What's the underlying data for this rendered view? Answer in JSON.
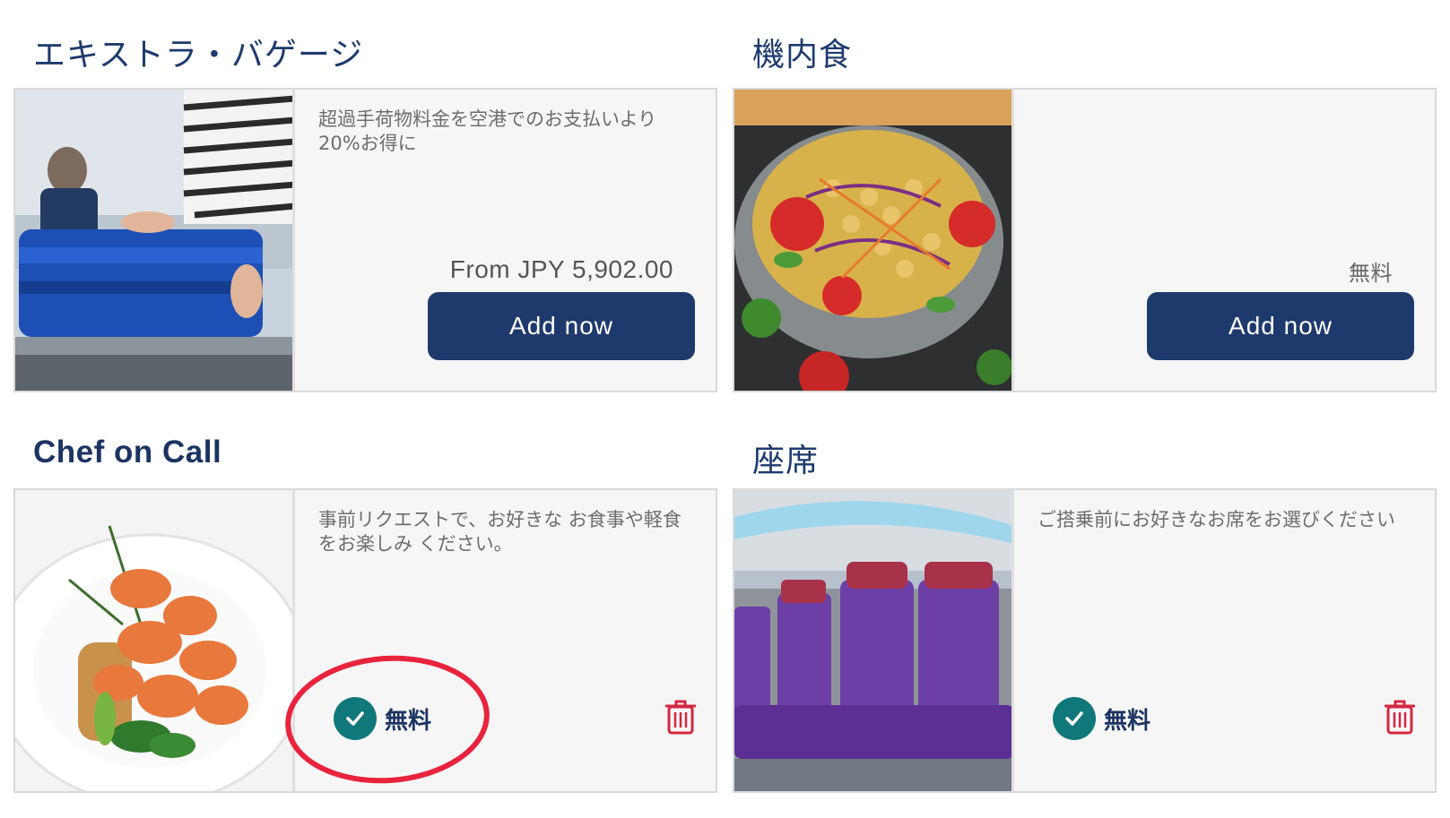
{
  "extra_baggage": {
    "title": "エキストラ・バゲージ",
    "description": "超過手荷物料金を空港でのお支払いより20%お得に",
    "price": "From JPY 5,902.00",
    "button": "Add now"
  },
  "inflight_meal": {
    "title": "機内食",
    "description": "",
    "price": "無料",
    "button": "Add now"
  },
  "chef_on_call": {
    "title": "Chef on Call",
    "description": "事前リクエストで、お好きな お食事や軽食をお楽しみ ください。",
    "status": "無料"
  },
  "seats": {
    "title": "座席",
    "description": "ご搭乗前にお好きなお席をお選びください",
    "status": "無料"
  },
  "colors": {
    "navy": "#1e3a6d",
    "teal_check": "#10787a",
    "trash_red": "#d3283f",
    "annotation_red": "#e8243c"
  },
  "icons": [
    "check-icon",
    "trash-icon"
  ]
}
